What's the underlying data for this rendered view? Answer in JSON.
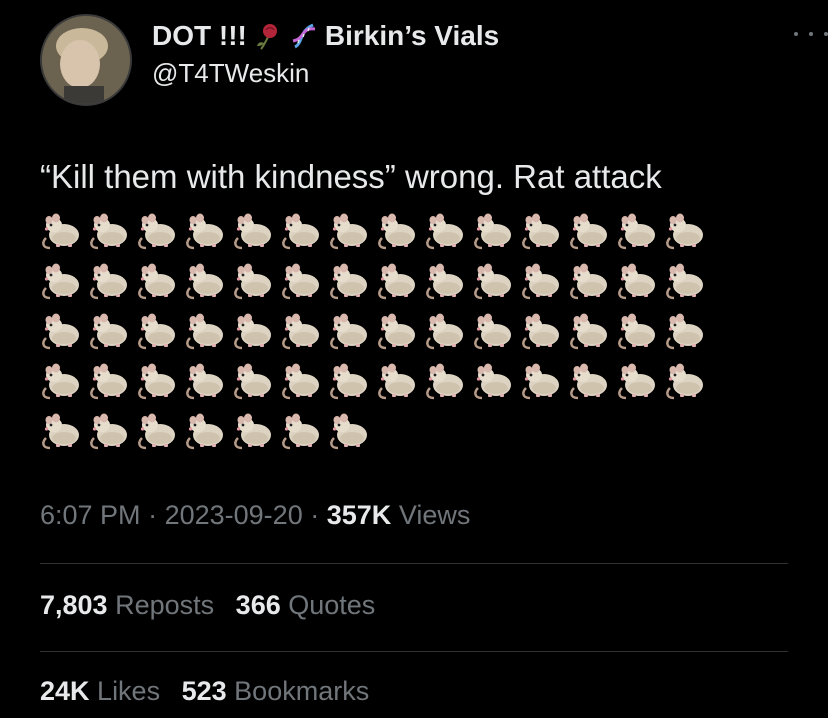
{
  "user": {
    "display_name": "DOT !!!",
    "display_name_suffix": "Birkin’s Vials",
    "handle": "@T4TWeskin",
    "name_icons": [
      "rose-icon",
      "dna-icon"
    ]
  },
  "tweet": {
    "text": "“Kill them with kindness” wrong. Rat attack",
    "rat_emoji_rows": [
      14,
      14,
      14,
      14,
      7
    ],
    "rat_emoji_icon": "rat-icon"
  },
  "meta": {
    "time": "6:07 PM",
    "separator": "·",
    "date": "2023-09-20",
    "views_count": "357K",
    "views_label": "Views"
  },
  "stats": {
    "reposts_count": "7,803",
    "reposts_label": "Reposts",
    "quotes_count": "366",
    "quotes_label": "Quotes",
    "likes_count": "24K",
    "likes_label": "Likes",
    "bookmarks_count": "523",
    "bookmarks_label": "Bookmarks"
  },
  "colors": {
    "background": "#000000",
    "primary_text": "#e7e9ea",
    "secondary_text": "#71767b",
    "divider": "#2f3336"
  }
}
